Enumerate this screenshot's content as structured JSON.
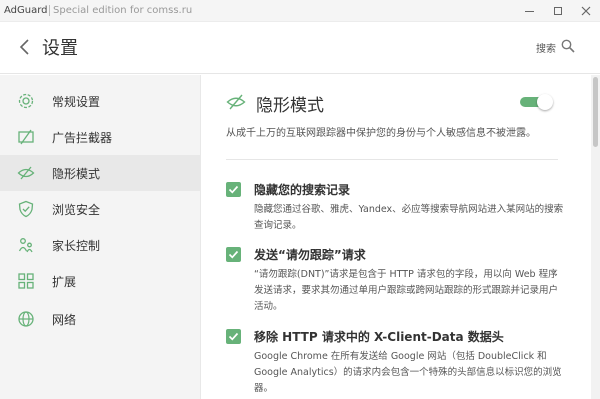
{
  "window": {
    "app_title": "AdGuard",
    "edition": "Special edition for comss.ru"
  },
  "header": {
    "title": "设置",
    "search_label": "搜索"
  },
  "sidebar": {
    "items": [
      {
        "label": "常规设置",
        "icon": "gear-icon"
      },
      {
        "label": "广告拦截器",
        "icon": "ad-block-icon"
      },
      {
        "label": "隐形模式",
        "icon": "eye-slash-icon",
        "active": true
      },
      {
        "label": "浏览安全",
        "icon": "shield-icon"
      },
      {
        "label": "家长控制",
        "icon": "family-icon"
      },
      {
        "label": "扩展",
        "icon": "extensions-icon"
      },
      {
        "label": "网络",
        "icon": "globe-icon"
      }
    ]
  },
  "main": {
    "title": "隐形模式",
    "toggle_on": true,
    "description": "从成千上万的互联网跟踪器中保护您的身份与个人敏感信息不被泄露。",
    "options": [
      {
        "checked": true,
        "title": "隐藏您的搜索记录",
        "description": "隐藏您通过谷歌、雅虎、Yandex、必应等搜索导航网站进入某网站的搜索查询记录。"
      },
      {
        "checked": true,
        "title": "发送“请勿跟踪”请求",
        "description": "“请勿跟踪(DNT)”请求是包含于 HTTP 请求包的字段，用以向 Web 程序发送请求，要求其勿通过单用户跟踪或跨网站跟踪的形式跟踪并记录用户活动。"
      },
      {
        "checked": true,
        "title": "移除 HTTP 请求中的 X-Client-Data 数据头",
        "description": "Google Chrome 在所有发送给 Google 网站（包括 DoubleClick 和 Google Analytics）的请求内会包含一个特殊的头部信息以标识您的浏览器。"
      }
    ]
  },
  "colors": {
    "accent": "#67b279",
    "sidebar_bg": "#f4f4f4",
    "active_item_bg": "#e8e8e8"
  }
}
